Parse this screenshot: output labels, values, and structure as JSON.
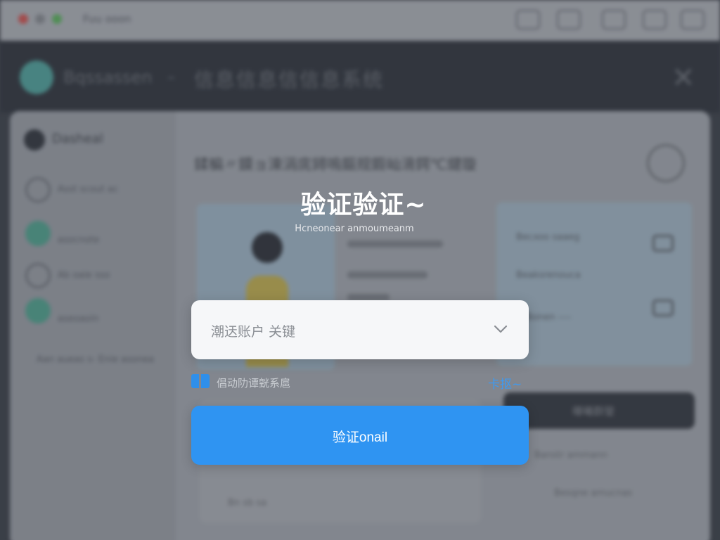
{
  "background": {
    "topbar_title": "Fuu ooon",
    "brand": "Bqssassen",
    "separator": "–",
    "app_title": "信息信息信信息系统",
    "close_glyph": "✕",
    "sidebar_header": "Dasheal",
    "sidebar_items": [
      "Asst scout ac",
      "asocnote",
      "Ab oaie sso",
      "aseoaoin",
      "Aan aueas s- Enie asonea"
    ],
    "content_title": "鍒楄〃鏌ョ湅涓庣鐞嗚鏂规鍜屾湇鍔℃煡璇",
    "blue_card_lines": [
      "Becxoo saaeg",
      "Beaksrenouca",
      "Bonen ----"
    ],
    "dark_button": "曝曦群瑩",
    "lower_texts": [
      "Bn sb  sa",
      "Banstr ammann",
      "Besqne amucnas"
    ]
  },
  "modal": {
    "title": "验证验证~",
    "subtitle": "Hcneonear anmoumeanm",
    "account_select": {
      "placeholder": "潮迗账户 关键"
    },
    "checkbox_label": "倡动阞谭皝系扈",
    "more_link": "卡抠~",
    "submit_label": "验证onail"
  },
  "colors": {
    "accent": "#2f94f2",
    "link": "#3e9af0",
    "header_bg": "#2d323a"
  },
  "icons": {
    "chevron": "chevron-down-icon",
    "close": "close-icon"
  }
}
